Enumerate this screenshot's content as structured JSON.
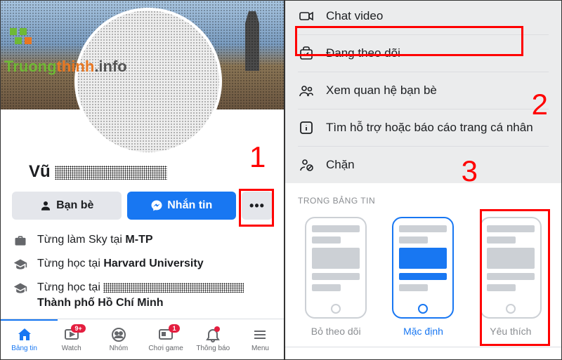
{
  "watermark": {
    "text_a": "Truong",
    "text_b": "thinh",
    "text_c": ".info"
  },
  "profile": {
    "name_prefix": "Vũ",
    "friends_btn": "Bạn bè",
    "message_btn": "Nhắn tin",
    "more_btn": "•••"
  },
  "about": {
    "items": [
      {
        "icon": "briefcase",
        "prefix": "Từng làm Sky tại ",
        "bold": "M-TP"
      },
      {
        "icon": "grad",
        "prefix": "Từng học tại ",
        "bold": "Harvard University"
      },
      {
        "icon": "grad",
        "prefix": "Từng học tại ",
        "suffix": "Thành phố Hồ Chí Minh"
      }
    ]
  },
  "bottom_nav": {
    "items": [
      {
        "label": "Bảng tin",
        "icon": "home",
        "active": true
      },
      {
        "label": "Watch",
        "icon": "tv",
        "badge": "9+"
      },
      {
        "label": "Nhóm",
        "icon": "group"
      },
      {
        "label": "Chơi game",
        "icon": "game",
        "badge": "1"
      },
      {
        "label": "Thông báo",
        "icon": "bell",
        "dot": true
      },
      {
        "label": "Menu",
        "icon": "menu"
      }
    ]
  },
  "menu": {
    "items": [
      {
        "icon": "camera",
        "label": "Chat video"
      },
      {
        "icon": "checkbag",
        "label": "Đang theo dõi"
      },
      {
        "icon": "people",
        "label": "Xem quan hệ bạn bè"
      },
      {
        "icon": "info",
        "label": "Tìm hỗ trợ hoặc báo cáo trang cá nhân"
      },
      {
        "icon": "block",
        "label": "Chặn"
      }
    ]
  },
  "feed_pref": {
    "title": "TRONG BẢNG TIN",
    "options": [
      {
        "label": "Bỏ theo dõi"
      },
      {
        "label": "Mặc định",
        "selected": true
      },
      {
        "label": "Yêu thích"
      }
    ]
  },
  "steps": {
    "s1": "1",
    "s2": "2",
    "s3": "3"
  }
}
